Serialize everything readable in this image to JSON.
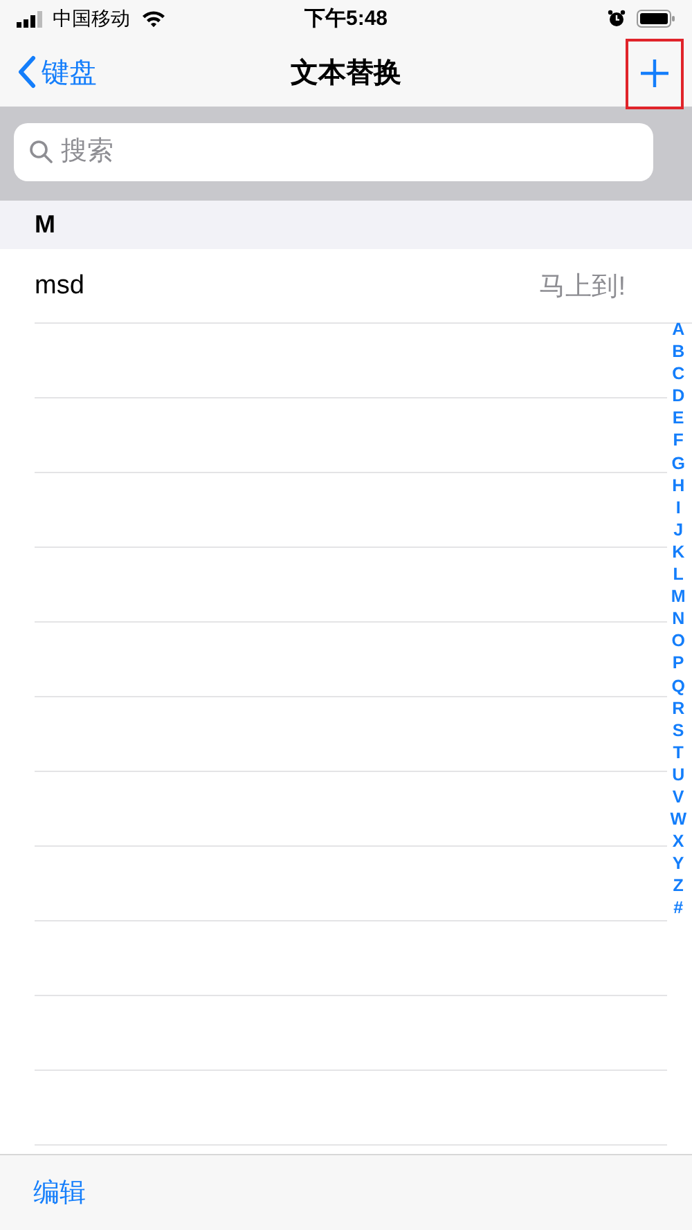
{
  "status_bar": {
    "carrier": "中国移动",
    "time": "下午5:48"
  },
  "nav": {
    "back_label": "键盘",
    "title": "文本替换",
    "add_button": {
      "highlighted": true
    }
  },
  "search": {
    "placeholder": "搜索"
  },
  "sections": [
    {
      "header": "M",
      "rows": [
        {
          "shortcut": "msd",
          "phrase": "马上到!"
        }
      ]
    }
  ],
  "index": [
    "A",
    "B",
    "C",
    "D",
    "E",
    "F",
    "G",
    "H",
    "I",
    "J",
    "K",
    "L",
    "M",
    "N",
    "O",
    "P",
    "Q",
    "R",
    "S",
    "T",
    "U",
    "V",
    "W",
    "X",
    "Y",
    "Z",
    "#"
  ],
  "toolbar": {
    "edit_label": "编辑"
  }
}
